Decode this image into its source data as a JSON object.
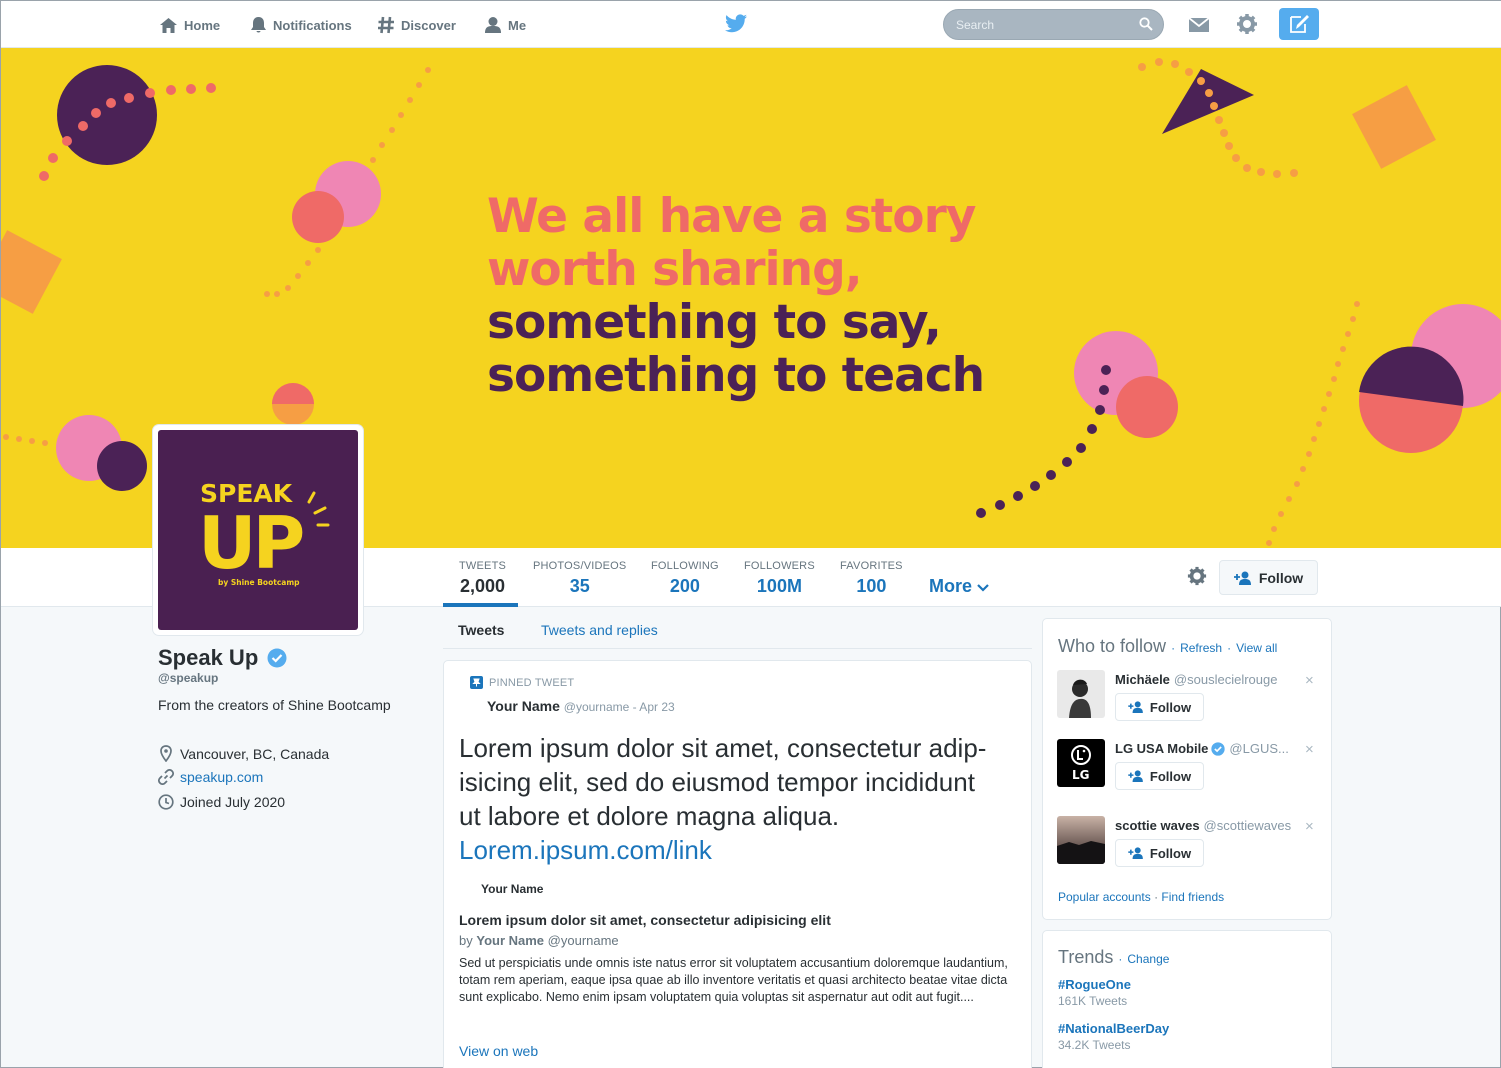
{
  "nav": {
    "home": "Home",
    "notifications": "Notifications",
    "discover": "Discover",
    "me": "Me",
    "search_placeholder": "Search"
  },
  "banner": {
    "line1": "We all have a story",
    "line2": "worth sharing,",
    "line3": "something to say,",
    "line4": "something to teach"
  },
  "avatar_logo": {
    "top": "SPEAK",
    "big": "UP",
    "sub": "by Shine Bootcamp"
  },
  "stats": [
    {
      "label": "TWEETS",
      "value": "2,000"
    },
    {
      "label": "PHOTOS/VIDEOS",
      "value": "35"
    },
    {
      "label": "FOLLOWING",
      "value": "200"
    },
    {
      "label": "FOLLOWERS",
      "value": "100M"
    },
    {
      "label": "FAVORITES",
      "value": "100"
    }
  ],
  "more_label": "More",
  "follow_label": "Follow",
  "profile": {
    "name": "Speak Up",
    "handle": "@speakup",
    "bio": "From the creators of Shine Bootcamp",
    "location": "Vancouver, BC, Canada",
    "website": "speakup.com",
    "joined": "Joined July 2020"
  },
  "tabs": {
    "tweets": "Tweets",
    "replies": "Tweets and replies"
  },
  "tweet": {
    "pinned_label": "PINNED TWEET",
    "author_name": "Your Name",
    "author_meta": "@yourname - Apr 23",
    "text_line1": "Lorem ipsum dolor sit amet, consectetur adip-",
    "text_line2": "isicing elit, sed do eiusmod tempor incididunt",
    "text_line3": "ut labore et dolore magna aliqua.",
    "link": "Lorem.ipsum.com/link",
    "card_author": "Your Name",
    "card_title": "Lorem ipsum dolor sit amet, consectetur adipisicing elit",
    "card_by_prefix": "by",
    "card_by_name": "Your Name",
    "card_by_handle": "@yourname",
    "card_desc": "Sed ut perspiciatis unde omnis iste natus error sit voluptatem accusantium doloremque laudantium, totam rem aperiam, eaque ipsa quae ab illo inventore veritatis et quasi architecto beatae vitae dicta sunt explicabo. Nemo enim ipsam voluptatem quia voluptas sit aspernatur aut odit aut fugit....",
    "view_on_web": "View on web"
  },
  "who_to_follow": {
    "title": "Who to follow",
    "refresh": "Refresh",
    "view_all": "View all",
    "sep": "·",
    "follow_label": "Follow",
    "close": "×",
    "suggestions": [
      {
        "name": "Michäele",
        "handle": "@souslecielrouge"
      },
      {
        "name": "LG USA Mobile",
        "handle": "@LGUS..."
      },
      {
        "name": "scottie waves",
        "handle": "@scottiewaves"
      }
    ],
    "lg_logo_text": "LG",
    "popular": "Popular accounts",
    "find_friends": "Find friends"
  },
  "trends": {
    "title": "Trends",
    "change": "Change",
    "items": [
      {
        "tag": "#RogueOne",
        "count": "161K Tweets"
      },
      {
        "tag": "#NationalBeerDay",
        "count": "34.2K Tweets"
      }
    ]
  },
  "colors": {
    "banner_bg": "#f5d31f",
    "coral": "#ef6a67",
    "plum": "#4b2256",
    "pink": "#ef86b4",
    "orange": "#f69e44",
    "link_blue": "#1b75bb",
    "twitter_blue": "#55acee"
  }
}
